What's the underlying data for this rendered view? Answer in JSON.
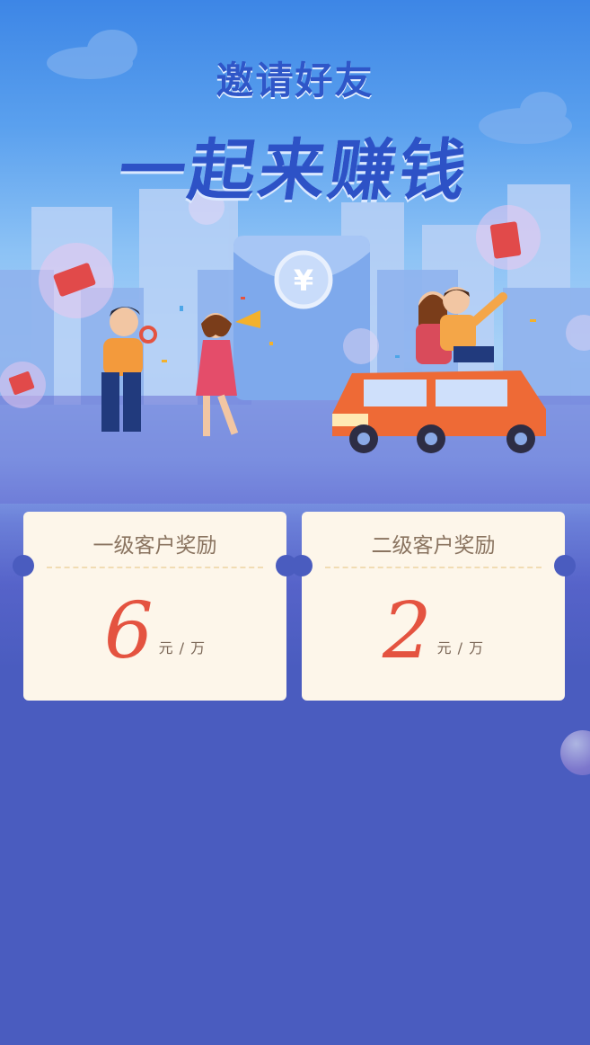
{
  "hero": {
    "headline_line1": "邀请好友",
    "headline_line2": "一起来赚钱",
    "envelope_symbol": "¥"
  },
  "rewards": [
    {
      "title": "一级客户奖励",
      "value": "6",
      "unit": "元 / 万"
    },
    {
      "title": "二级客户奖励",
      "value": "2",
      "unit": "元 / 万"
    }
  ],
  "colors": {
    "background": "#4a5cbf",
    "card_bg": "#fdf6ea",
    "value_red": "#e45340",
    "title_blue": "#2f56c8"
  }
}
